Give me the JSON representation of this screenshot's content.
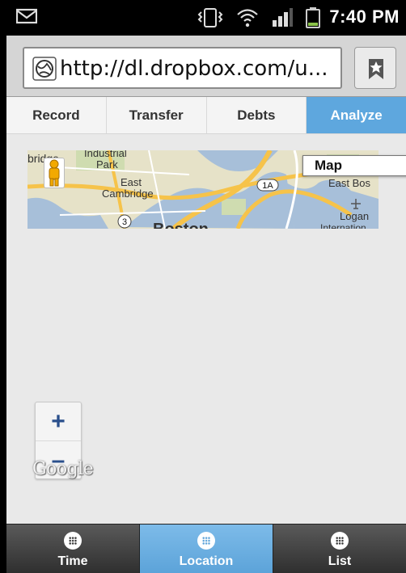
{
  "status_bar": {
    "time": "7:40 PM",
    "icons": [
      "mail-icon",
      "vibrate-icon",
      "wifi-icon",
      "signal-icon",
      "battery-icon"
    ]
  },
  "browser": {
    "url": "http://dl.dropbox.com/u...",
    "bookmark_icon": "bookmark-star-icon"
  },
  "tabs": [
    {
      "label": "Record",
      "active": false
    },
    {
      "label": "Transfer",
      "active": false
    },
    {
      "label": "Debts",
      "active": false
    },
    {
      "label": "Analyze",
      "active": true
    }
  ],
  "map": {
    "map_type_label": "Map",
    "zoom_in_label": "+",
    "zoom_out_label": "–",
    "logo_text": "Google",
    "labels": {
      "l1": "bridge",
      "l2": "Industrial",
      "l3": "Park",
      "l4": "East",
      "l5": "Cambridge",
      "l6": "Boston",
      "l7": "East Bos",
      "l8": "Logan",
      "l9": "Internation",
      "r1": "1A",
      "r2": "3"
    }
  },
  "bottom_nav": [
    {
      "label": "Time",
      "active": false
    },
    {
      "label": "Location",
      "active": true
    },
    {
      "label": "List",
      "active": false
    }
  ],
  "colors": {
    "accent": "#5ea7de",
    "nav_dark": "#3a3a3a"
  }
}
